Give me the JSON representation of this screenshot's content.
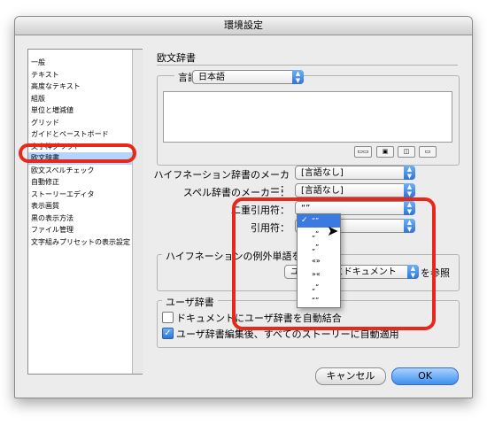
{
  "window": {
    "title": "環境設定"
  },
  "sidebar": {
    "items": [
      {
        "label": "一般",
        "selected": false
      },
      {
        "label": "テキスト",
        "selected": false
      },
      {
        "label": "高度なテキスト",
        "selected": false
      },
      {
        "label": "組版",
        "selected": false
      },
      {
        "label": "単位と増減値",
        "selected": false
      },
      {
        "label": "グリッド",
        "selected": false
      },
      {
        "label": "ガイドとペーストボード",
        "selected": false
      },
      {
        "label": "文字枠グリッド",
        "selected": false
      },
      {
        "label": "欧文辞書",
        "selected": true
      },
      {
        "label": "欧文スペルチェック",
        "selected": false
      },
      {
        "label": "自動修正",
        "selected": false
      },
      {
        "label": "ストーリーエディタ",
        "selected": false
      },
      {
        "label": "表示画質",
        "selected": false
      },
      {
        "label": "黒の表示方法",
        "selected": false
      },
      {
        "label": "ファイル管理",
        "selected": false
      },
      {
        "label": "文字組みプリセットの表示設定",
        "selected": false
      }
    ]
  },
  "main": {
    "section_title": "欧文辞書",
    "language_label": "言語：",
    "language_value": "日本語",
    "hyphenation_vendor_label": "ハイフネーション辞書のメーカー：",
    "hyphenation_vendor_value": "[言語なし]",
    "spelling_vendor_label": "スペル辞書のメーカー：",
    "spelling_vendor_value": "[言語なし]",
    "double_quotes_label": "二重引用符：",
    "double_quotes_value": "“”",
    "single_quotes_label": "引用符：",
    "single_quotes_value": "",
    "quotes_options": [
      "“”",
      "„“",
      "„”",
      "«»",
      "»«",
      "„“",
      "“”"
    ],
    "hyph_exceptions_label": "ハイフネーションの例外単語を参照",
    "hyph_exceptions_value": "ユーザ辞書とドキュメント",
    "hyph_exceptions_suffix": "を参照",
    "user_dict_label": "ユーザ辞書",
    "user_dict_opt1": "ドキュメントにユーザ辞書を自動結合",
    "user_dict_opt1_checked": false,
    "user_dict_opt2": "ユーザ辞書編集後、すべてのストーリーに自動適用",
    "user_dict_opt2_checked": true
  },
  "buttons": {
    "cancel": "キャンセル",
    "ok": "OK"
  },
  "colors": {
    "highlight": "#e8281a",
    "accent": "#3b7ae0",
    "selection": "#b5d5ff"
  }
}
